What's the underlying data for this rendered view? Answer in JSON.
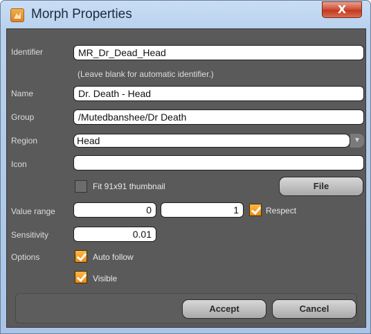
{
  "window": {
    "title": "Morph Properties",
    "close_label": "X"
  },
  "form": {
    "identifier_label": "Identifier",
    "identifier_value": "MR_Dr_Dead_Head",
    "identifier_hint": "(Leave blank for automatic identifier.)",
    "name_label": "Name",
    "name_value": "Dr. Death - Head",
    "group_label": "Group",
    "group_value": "/Mutedbanshee/Dr Death",
    "region_label": "Region",
    "region_value": "Head",
    "icon_label": "Icon",
    "icon_value": "",
    "fit_thumbnail_label": "Fit 91x91 thumbnail",
    "fit_thumbnail_checked": false,
    "file_button": "File",
    "value_range_label": "Value range",
    "value_range_min": "0",
    "value_range_max": "1",
    "respect_label": "Respect",
    "respect_checked": true,
    "sensitivity_label": "Sensitivity",
    "sensitivity_value": "0.01",
    "options_label": "Options",
    "auto_follow_label": "Auto follow",
    "auto_follow_checked": true,
    "visible_label": "Visible",
    "visible_checked": true
  },
  "footer": {
    "accept_button": "Accept",
    "cancel_button": "Cancel"
  }
}
